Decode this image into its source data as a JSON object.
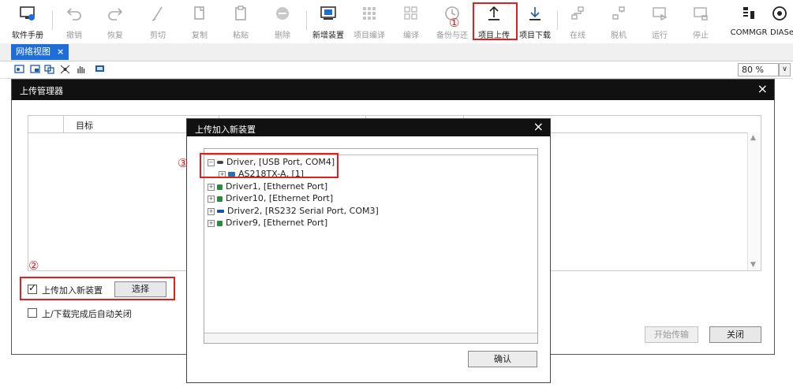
{
  "toolbar": {
    "items": [
      {
        "label": "软件手册",
        "icon": "monitor-help-icon",
        "enabled": true
      },
      {
        "label": "撤销",
        "icon": "undo-icon",
        "enabled": false
      },
      {
        "label": "恢复",
        "icon": "redo-icon",
        "enabled": false
      },
      {
        "label": "剪切",
        "icon": "cut-icon",
        "enabled": false
      },
      {
        "label": "复制",
        "icon": "copy-icon",
        "enabled": false
      },
      {
        "label": "粘贴",
        "icon": "paste-icon",
        "enabled": false
      },
      {
        "label": "删除",
        "icon": "delete-icon",
        "enabled": false
      },
      {
        "label": "新增装置",
        "icon": "add-device-icon",
        "enabled": true
      },
      {
        "label": "项目编译",
        "icon": "grid-compile-icon",
        "enabled": false
      },
      {
        "label": "编译",
        "icon": "compile-icon",
        "enabled": false
      },
      {
        "label": "备份与还",
        "icon": "backup-clock-icon",
        "enabled": false
      },
      {
        "label": "项目上传",
        "icon": "upload-arrow-icon",
        "enabled": true
      },
      {
        "label": "项目下载",
        "icon": "download-arrow-icon",
        "enabled": true
      },
      {
        "label": "在线",
        "icon": "online-icon",
        "enabled": false
      },
      {
        "label": "脱机",
        "icon": "offline-icon",
        "enabled": false
      },
      {
        "label": "运行",
        "icon": "run-icon",
        "enabled": false
      },
      {
        "label": "停止",
        "icon": "stop-icon",
        "enabled": false
      },
      {
        "label": "COMMGR",
        "icon": "commgr-icon",
        "enabled": true
      },
      {
        "label": "DIASel",
        "icon": "diasel-icon",
        "enabled": true
      }
    ]
  },
  "annotations": {
    "one": "①",
    "two": "②",
    "three": "③"
  },
  "tab": {
    "label": "网络视图",
    "close": "×"
  },
  "zoom": {
    "value": "80 %",
    "arrow": "∨"
  },
  "upload_manager": {
    "title": "上传管理器",
    "close": "×",
    "grid_header": "目标",
    "checkbox_add_new": {
      "label": "上传加入新装置",
      "checked": true
    },
    "select_button": "选择",
    "checkbox_auto_close": {
      "label": "上/下载完成后自动关闭",
      "checked": false
    },
    "start_button": "开始传输",
    "close_button": "关闭"
  },
  "add_device_dialog": {
    "title": "上传加入新装置",
    "close": "×",
    "tree": [
      {
        "label": "Driver,  [USB Port, COM4]",
        "expanded": true,
        "children": [
          {
            "label": "AS218TX-A, [1]"
          }
        ]
      },
      {
        "label": "Driver1,  [Ethernet Port]"
      },
      {
        "label": "Driver10,  [Ethernet Port]"
      },
      {
        "label": "Driver2,  [RS232 Serial Port, COM3]"
      },
      {
        "label": "Driver9,  [Ethernet Port]"
      }
    ],
    "confirm_button": "确认"
  },
  "colors": {
    "accent": "#1e6ed8",
    "highlight": "#e02020",
    "title_bar": "#111111"
  }
}
